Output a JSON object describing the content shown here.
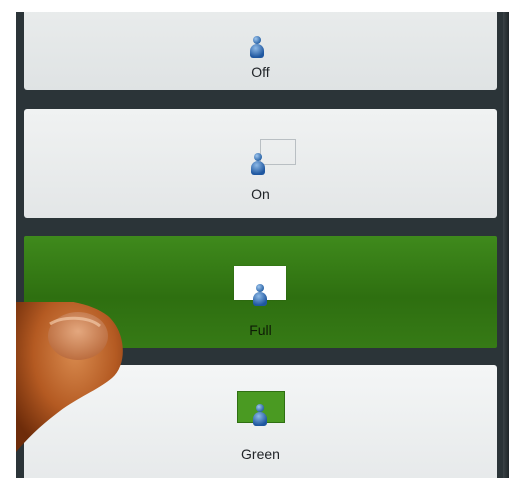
{
  "options": [
    {
      "label": "Off",
      "selected": false
    },
    {
      "label": "On",
      "selected": false
    },
    {
      "label": "Full",
      "selected": true
    },
    {
      "label": "Green",
      "selected": false
    }
  ],
  "colors": {
    "selected_bg": "#2e6f10",
    "unselected_bg": "#e6e9ea",
    "divider": "#2b3438",
    "icon_blue": "#1f57a0"
  },
  "icons": {
    "off": "person-icon",
    "on": "person-in-outline-screen-icon",
    "full": "person-in-white-screen-icon",
    "green": "person-in-green-screen-icon"
  }
}
